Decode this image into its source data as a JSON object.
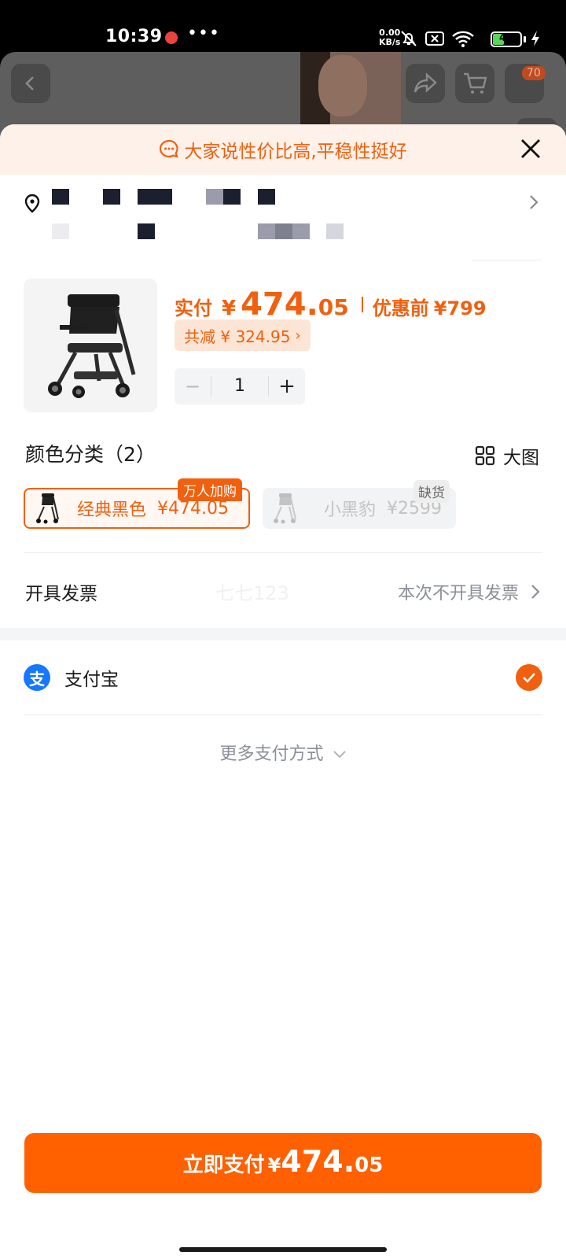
{
  "status_bar": {
    "time": "10:39",
    "more": "•••",
    "net_speed_value": "0.00",
    "net_speed_unit": "KB/s",
    "battery": "40",
    "battery_level_fraction": 0.4,
    "icons": [
      "app-notification-icon",
      "mute-bell-icon",
      "screen-record-icon",
      "wifi-icon",
      "battery-icon",
      "charging-icon"
    ]
  },
  "background_page": {
    "cart_badge": "70",
    "icons": [
      "back-icon",
      "share-icon",
      "cart-icon"
    ]
  },
  "banner": {
    "text": "大家说性价比高,平稳性挺好",
    "icon": "chat-bubble-icon",
    "color": "#f0600f"
  },
  "product": {
    "price_label": "实付",
    "currency": "¥",
    "price_int": "474.",
    "price_dec": "05",
    "original_label": "优惠前",
    "original_price": "¥799",
    "discount": "共减 ¥ 324.95",
    "quantity": "1",
    "minus": "−",
    "plus": "+"
  },
  "variants": {
    "title": "颜色分类（2）",
    "big_image_label": "大图",
    "options": [
      {
        "name": "经典黑色",
        "price": "¥474.05",
        "tag": "万人加购",
        "selected": true
      },
      {
        "name": "小黑豹",
        "price": "¥2599",
        "tag": "缺货",
        "selected": false
      }
    ]
  },
  "invoice": {
    "label": "开具发票",
    "watermark": "七七123",
    "value": "本次不开具发票"
  },
  "payment": {
    "method": "支付宝",
    "logo_char": "支",
    "more": "更多支付方式"
  },
  "pay_button": {
    "label": "立即支付",
    "currency": "¥",
    "amount_int": "474.",
    "amount_dec": "05",
    "color": "#ff6000"
  }
}
